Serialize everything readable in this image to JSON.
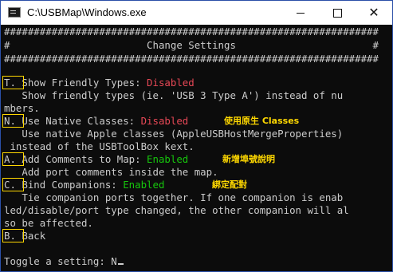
{
  "window": {
    "title": "C:\\USBMap\\Windows.exe",
    "icon": "console-app-icon",
    "controls": {
      "minimize": "minimize",
      "maximize": "maximize",
      "close": "✕"
    }
  },
  "console": {
    "border_top": "###############################################################",
    "header_title": "#                       Change Settings                       #",
    "border_bottom": "###############################################################",
    "options": [
      {
        "key": "T.",
        "label": " Show Friendly Types: ",
        "status": "Disabled",
        "status_color": "#e74856",
        "description": [
          "   Show friendly types (ie. 'USB 3 Type A') instead of nu",
          "mbers."
        ]
      },
      {
        "key": "N.",
        "label": " Use Native Classes: ",
        "status": "Disabled",
        "status_color": "#e74856",
        "description": [
          "   Use native Apple classes (AppleUSBHostMergeProperties)",
          " instead of the USBToolBox kext."
        ]
      },
      {
        "key": "A.",
        "label": " Add Comments to Map: ",
        "status": "Enabled",
        "status_color": "#16c60c",
        "description": [
          "   Add port comments inside the map."
        ]
      },
      {
        "key": "C.",
        "label": " Bind Companions: ",
        "status": "Enabled",
        "status_color": "#16c60c",
        "description": [
          "   Tie companion ports together. If one companion is enab",
          "led/disable/port type changed, the other companion will al",
          "so be affected."
        ]
      }
    ],
    "back": {
      "key": "B.",
      "label": " Back"
    },
    "prompt": "Toggle a setting: N"
  },
  "annotations": {
    "native_classes": "使用原生 Classes",
    "comments": "新增埠號說明",
    "companions": "綁定配對",
    "color": "#ffd800"
  }
}
